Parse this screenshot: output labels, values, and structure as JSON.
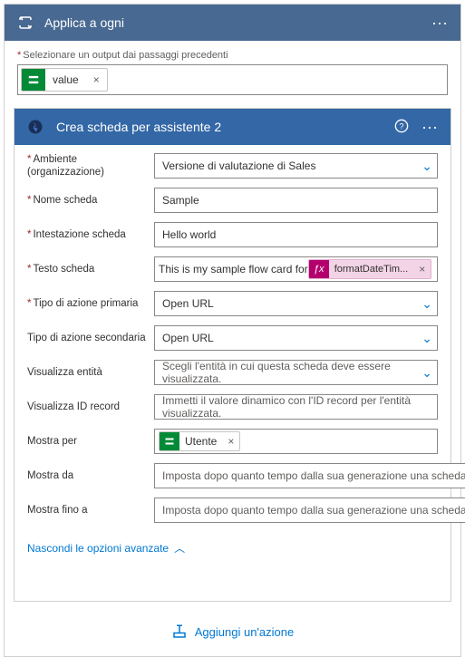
{
  "outer": {
    "title": "Applica a ogni",
    "select_label": "Selezionare un output dai passaggi precedenti",
    "value_chip": "value"
  },
  "inner": {
    "title": "Crea scheda per assistente 2"
  },
  "fields": {
    "env": {
      "label": "Ambiente (organizzazione)",
      "value": "Versione di valutazione di Sales"
    },
    "card_name": {
      "label": "Nome scheda",
      "value": "Sample"
    },
    "card_header": {
      "label": "Intestazione scheda",
      "value": "Hello world"
    },
    "card_text": {
      "label": "Testo scheda",
      "prefix": "This is my sample flow card for ",
      "fx_name": "formatDateTim..."
    },
    "primary_action": {
      "label": "Tipo di azione primaria",
      "value": "Open URL"
    },
    "secondary_action": {
      "label": "Tipo di azione secondaria",
      "value": "Open URL"
    },
    "view_entity": {
      "label": "Visualizza entità",
      "placeholder": "Scegli l'entità in cui questa scheda deve essere visualizzata."
    },
    "view_record": {
      "label": "Visualizza ID record",
      "placeholder": "Immetti il valore dinamico con l'ID record per l'entità visualizzata."
    },
    "show_for": {
      "label": "Mostra per",
      "chip": "Utente"
    },
    "show_from": {
      "label": "Mostra da",
      "placeholder": "Imposta dopo quanto tempo dalla sua generazione una scheda deve essere mostrata."
    },
    "show_until": {
      "label": "Mostra fino a",
      "placeholder": "Imposta dopo quanto tempo dalla sua generazione una scheda deve scadere. I"
    }
  },
  "advanced_link": "Nascondi le opzioni avanzate",
  "add_action": "Aggiungi un'azione"
}
